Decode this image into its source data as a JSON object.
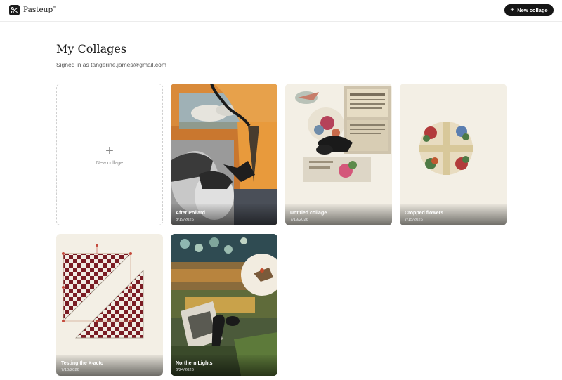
{
  "app": {
    "name": "Pasteup",
    "trademark": "™",
    "logo_icon": "scissors-icon"
  },
  "header": {
    "new_collage_label": "New collage"
  },
  "main": {
    "title": "My Collages",
    "signed_in_text": "Signed in as tangerine.james@gmail.com",
    "new_card_label": "New collage"
  },
  "collages": [
    {
      "title": "After Pollard",
      "date": "8/19/2026"
    },
    {
      "title": "Untitled collage",
      "date": "7/19/2026"
    },
    {
      "title": "Cropped flowers",
      "date": "7/15/2026"
    },
    {
      "title": "Testing the X-acto",
      "date": "7/10/2026"
    },
    {
      "title": "Northern Lights",
      "date": "6/24/2026"
    }
  ],
  "colors": {
    "accent": "#161616",
    "card_bg": "#f3efe5",
    "quilt_red": "#7a1c24"
  }
}
